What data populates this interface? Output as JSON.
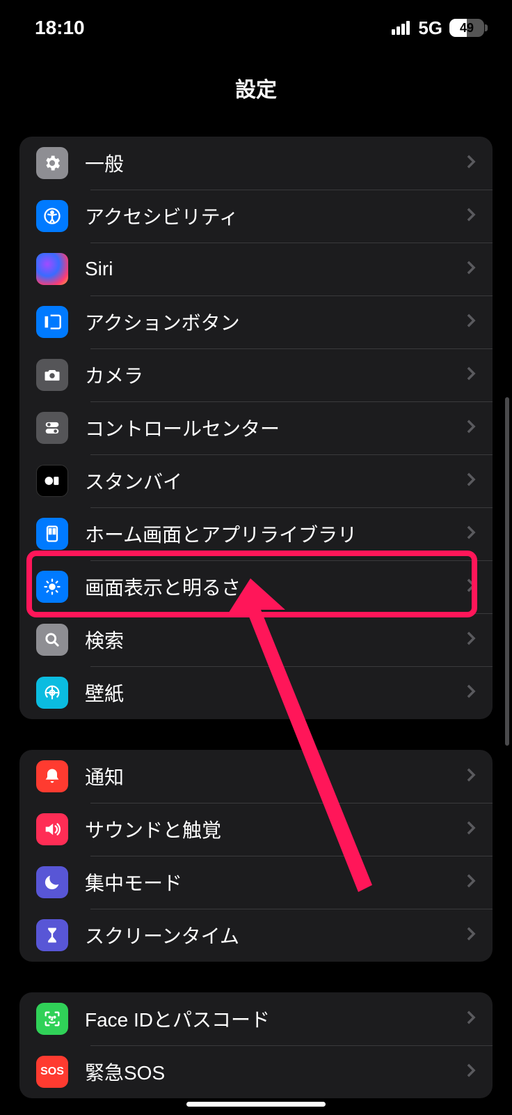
{
  "status": {
    "time": "18:10",
    "network": "5G",
    "battery": "49"
  },
  "title": "設定",
  "groups": [
    {
      "rows": [
        {
          "id": "general",
          "label": "一般"
        },
        {
          "id": "accessibility",
          "label": "アクセシビリティ"
        },
        {
          "id": "siri",
          "label": "Siri"
        },
        {
          "id": "action-button",
          "label": "アクションボタン"
        },
        {
          "id": "camera",
          "label": "カメラ"
        },
        {
          "id": "control-center",
          "label": "コントロールセンター"
        },
        {
          "id": "standby",
          "label": "スタンバイ"
        },
        {
          "id": "home-screen",
          "label": "ホーム画面とアプリライブラリ"
        },
        {
          "id": "display",
          "label": "画面表示と明るさ"
        },
        {
          "id": "search",
          "label": "検索"
        },
        {
          "id": "wallpaper",
          "label": "壁紙"
        }
      ]
    },
    {
      "rows": [
        {
          "id": "notifications",
          "label": "通知"
        },
        {
          "id": "sounds",
          "label": "サウンドと触覚"
        },
        {
          "id": "focus",
          "label": "集中モード"
        },
        {
          "id": "screen-time",
          "label": "スクリーンタイム"
        }
      ]
    },
    {
      "rows": [
        {
          "id": "face-id",
          "label": "Face IDとパスコード"
        },
        {
          "id": "sos",
          "label": "緊急SOS"
        }
      ]
    }
  ],
  "annotation": {
    "highlight_row": "display"
  }
}
